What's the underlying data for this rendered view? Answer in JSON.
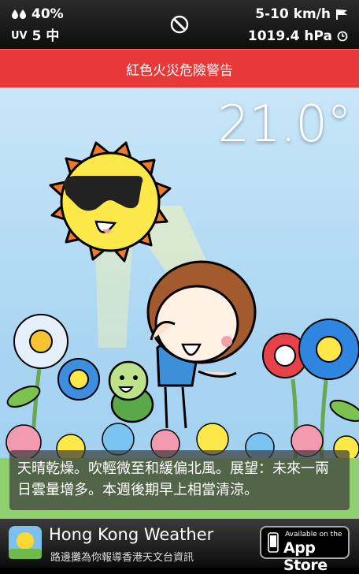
{
  "status": {
    "humidity": "40%",
    "uv_label": "UV",
    "uv_value": "5 中",
    "wind": "5-10 km/h",
    "pressure": "1019.4 hPa"
  },
  "alert": {
    "text": "紅色火災危險警告"
  },
  "weather": {
    "temperature": "21.0°",
    "forecast": "天晴乾燥。吹輕微至和緩偏北風。展望：未來一兩日雲量增多。本週後期早上相當清涼。"
  },
  "ad": {
    "title": "Hong Kong Weather",
    "subtitle": "路邊攤為你報導香港天文台資訊",
    "store_line1": "Available on the",
    "store_line2": "App Store"
  },
  "icons": [
    "droplets-icon",
    "flag-icon",
    "clock-icon",
    "no-entry-icon",
    "sun-app-icon",
    "phone-icon"
  ]
}
